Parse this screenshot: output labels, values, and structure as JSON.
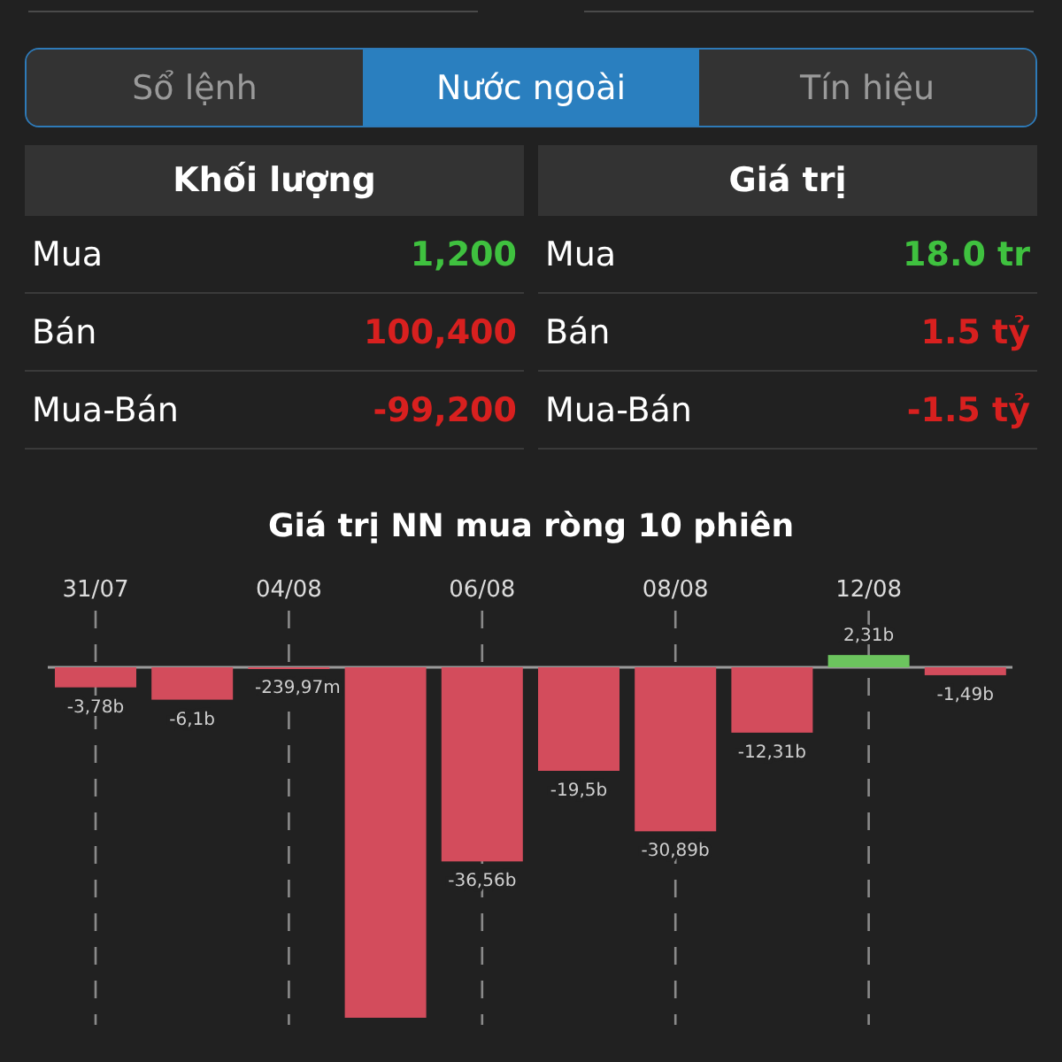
{
  "tabs": [
    {
      "label": "Sổ lệnh",
      "selected": false
    },
    {
      "label": "Nước ngoài",
      "selected": true
    },
    {
      "label": "Tín hiệu",
      "selected": false
    }
  ],
  "panels": [
    {
      "header": "Khối lượng",
      "rows": [
        {
          "label": "Mua",
          "value": "1,200",
          "color": "#3fc13f"
        },
        {
          "label": "Bán",
          "value": "100,400",
          "color": "#d8201f"
        },
        {
          "label": "Mua-Bán",
          "value": "-99,200",
          "color": "#d8201f"
        }
      ]
    },
    {
      "header": "Giá trị",
      "rows": [
        {
          "label": "Mua",
          "value": "18.0 tr",
          "color": "#3fc13f"
        },
        {
          "label": "Bán",
          "value": "1.5 tỷ",
          "color": "#d8201f"
        },
        {
          "label": "Mua-Bán",
          "value": "-1.5 tỷ",
          "color": "#d8201f"
        }
      ]
    }
  ],
  "chart_data": {
    "type": "bar",
    "title": "Giá trị NN mua ròng 10 phiên",
    "grid": true,
    "categories": [
      "31/07",
      null,
      "04/08",
      null,
      "06/08",
      null,
      "08/08",
      null,
      "12/08",
      null
    ],
    "values": [
      -3780000000,
      -6100000000,
      -239970000,
      -66000000000,
      -36560000000,
      -19500000000,
      -30890000000,
      -12310000000,
      2310000000,
      -1490000000
    ],
    "value_labels": [
      "-3,78b",
      "-6,1b",
      "-239,97m",
      null,
      "-36,56b",
      "-19,5b",
      "-30,89b",
      "-12,31b",
      "2,31b",
      "-1,49b"
    ]
  }
}
